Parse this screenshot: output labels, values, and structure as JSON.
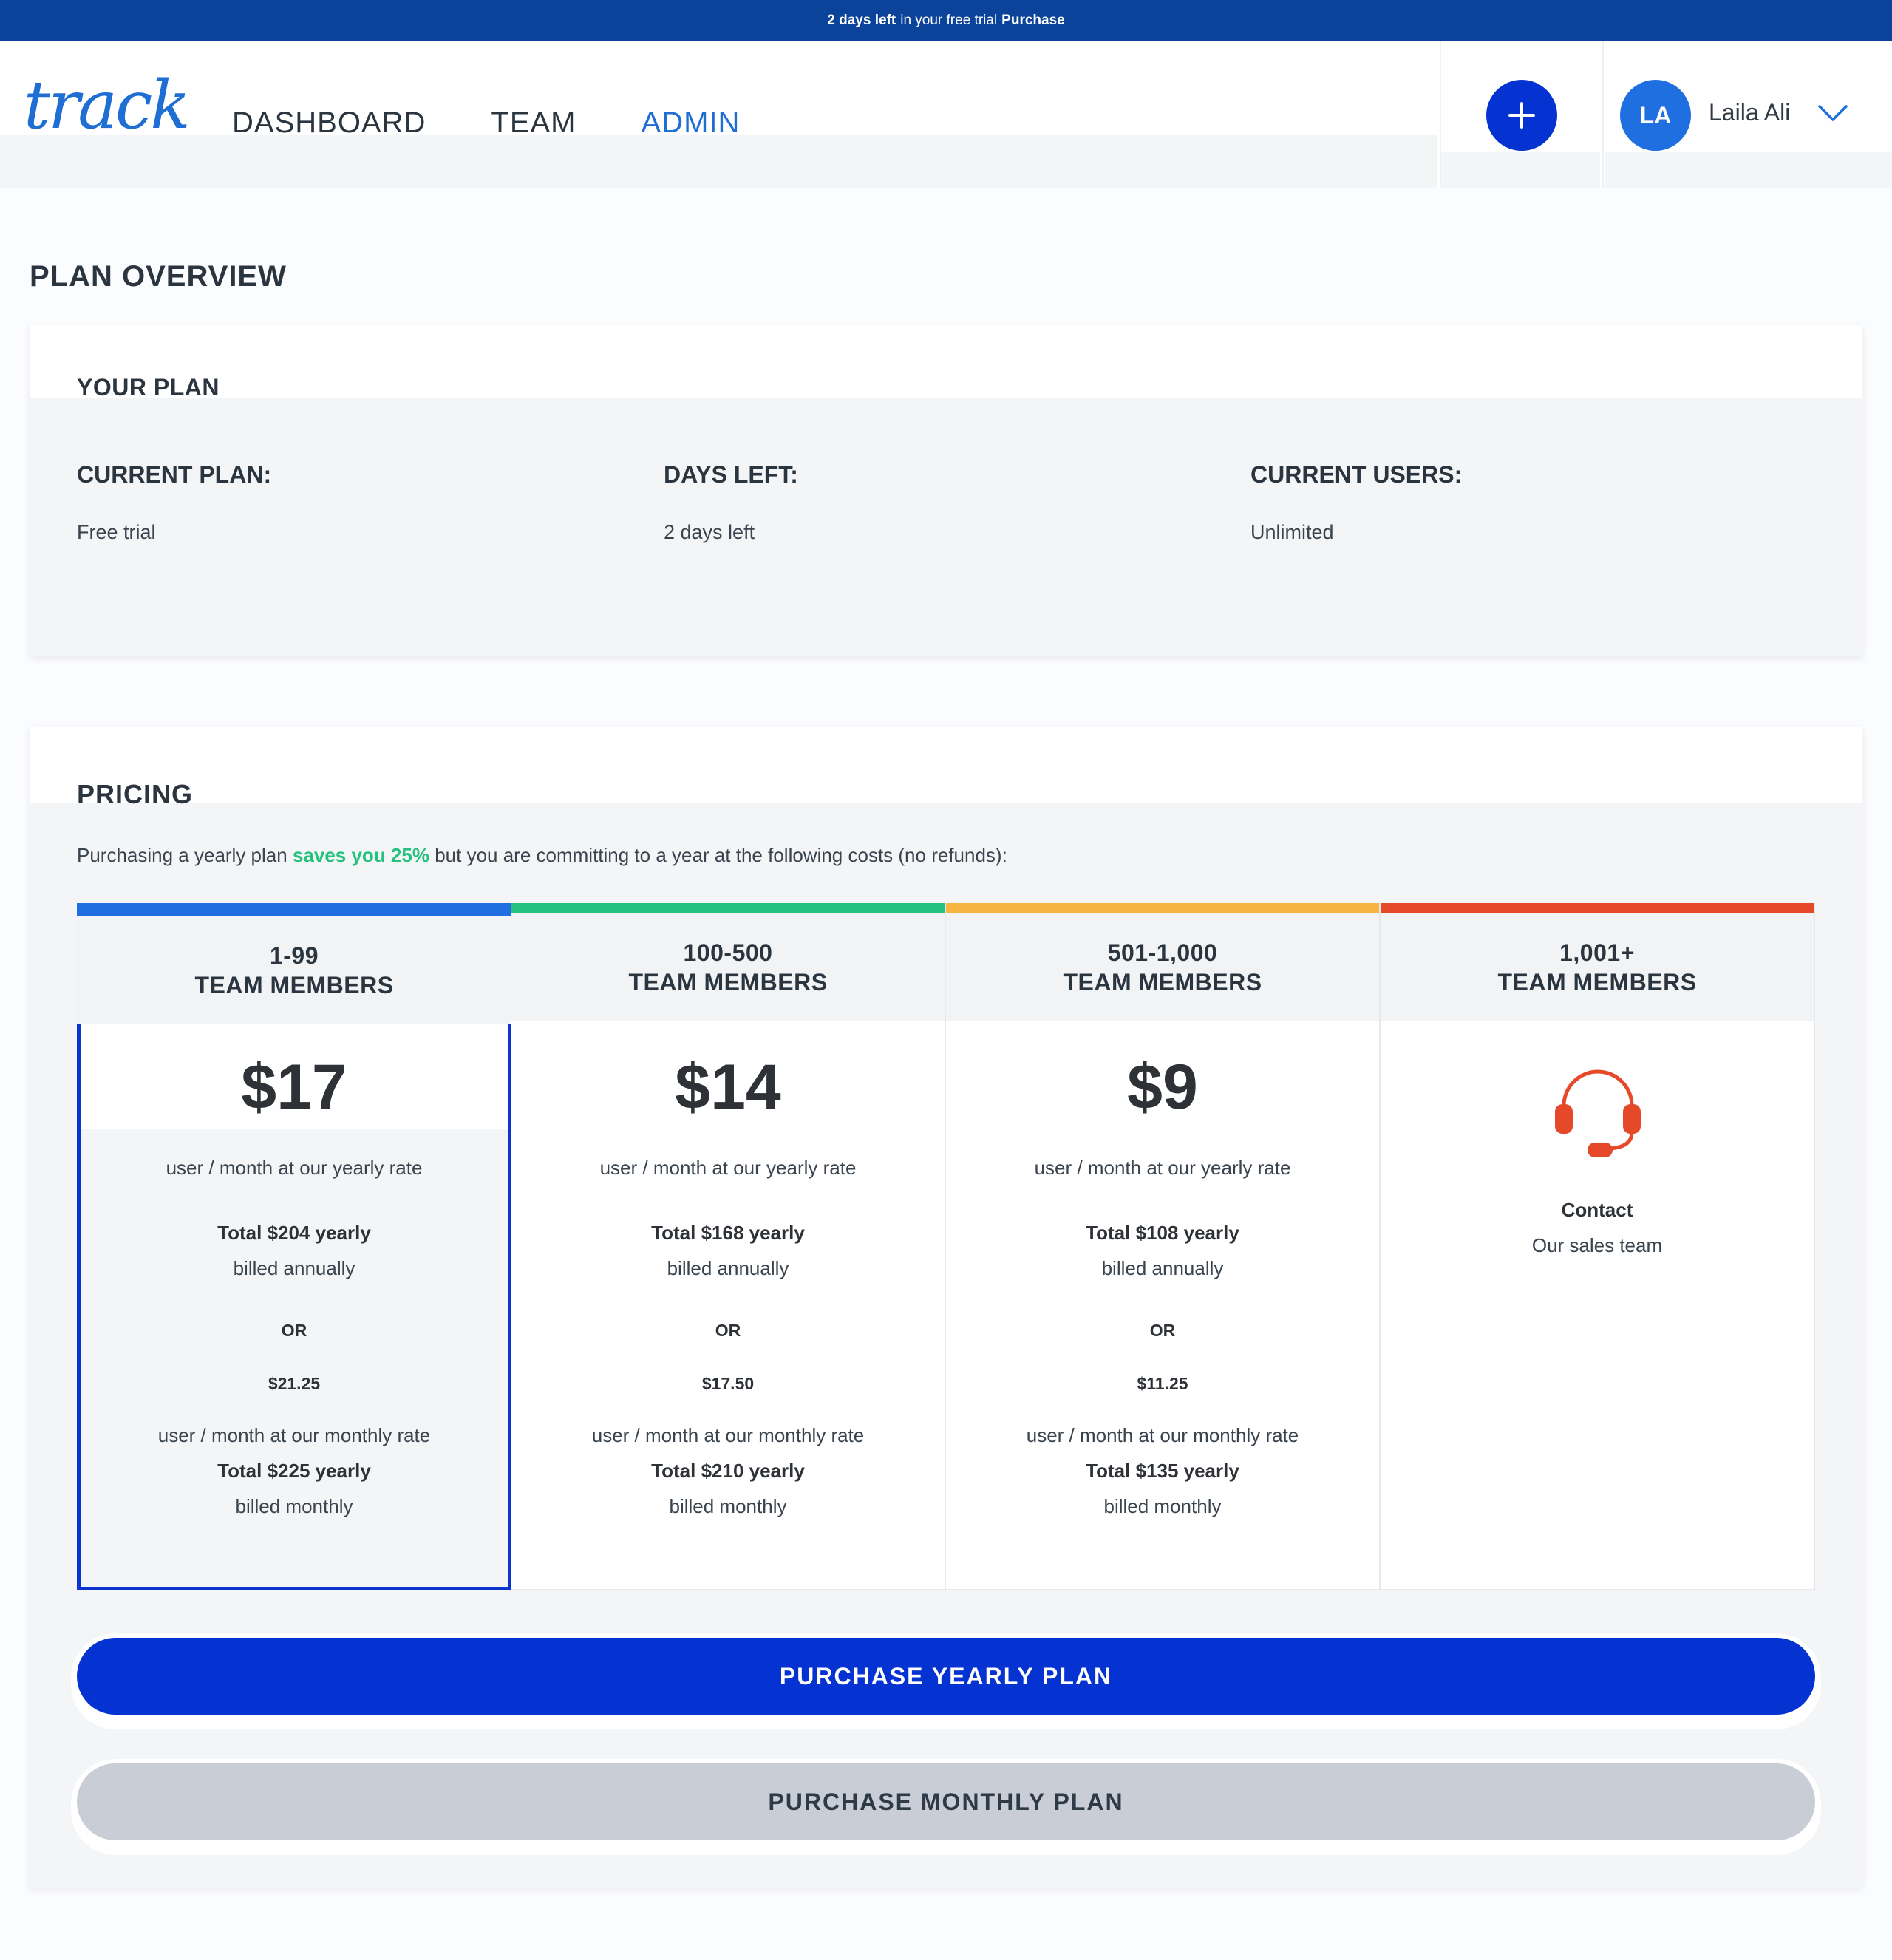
{
  "banner": {
    "days_left": "2 days left",
    "text": "in your free trial",
    "purchase": "Purchase"
  },
  "header": {
    "logo": "track",
    "nav": [
      "DASHBOARD",
      "TEAM",
      "ADMIN"
    ],
    "active_nav": "ADMIN",
    "add_icon": "plus-icon",
    "user_initials": "LA",
    "user_name": "Laila Ali",
    "user_menu_icon": "chevron-down-icon"
  },
  "page_title": "PLAN OVERVIEW",
  "your_plan": {
    "title": "YOUR PLAN",
    "current_plan_label": "CURRENT PLAN:",
    "current_plan_value": "Free trial",
    "days_left_label": "DAYS LEFT:",
    "days_left_value": "2 days left",
    "current_users_label": "CURRENT USERS:",
    "current_users_value": "Unlimited"
  },
  "pricing": {
    "title": "PRICING",
    "intro_before": "Purchasing a yearly plan",
    "intro_highlight": "saves you 25%",
    "intro_after": "but you are committing to a year at the following costs (no refunds):",
    "highlight_color": "#25c27f",
    "tiers": [
      {
        "range": "1-99",
        "members": "TEAM MEMBERS",
        "color": "#1f6fe0",
        "price": "$17",
        "yearly_rate": "user / month at our yearly rate",
        "yearly_total": "Total $204 yearly",
        "yearly_billing": "billed annually",
        "or": "OR",
        "monthly_price": "$21.25",
        "monthly_rate": "user / month at our monthly rate",
        "monthly_total": "Total $225 yearly",
        "monthly_billing": "billed monthly",
        "selected": true
      },
      {
        "range": "100-500",
        "members": "TEAM MEMBERS",
        "color": "#25c27f",
        "price": "$14",
        "yearly_rate": "user / month at our yearly rate",
        "yearly_total": "Total $168 yearly",
        "yearly_billing": "billed annually",
        "or": "OR",
        "monthly_price": "$17.50",
        "monthly_rate": "user / month at our monthly rate",
        "monthly_total": "Total $210 yearly",
        "monthly_billing": "billed monthly"
      },
      {
        "range": "501-1,000",
        "members": "TEAM MEMBERS",
        "color": "#f8b441",
        "price": "$9",
        "yearly_rate": "user / month at our yearly rate",
        "yearly_total": "Total $108 yearly",
        "yearly_billing": "billed annually",
        "or": "OR",
        "monthly_price": "$11.25",
        "monthly_rate": "user / month at our monthly rate",
        "monthly_total": "Total $135 yearly",
        "monthly_billing": "billed monthly"
      },
      {
        "range": "1,001+",
        "members": "TEAM MEMBERS",
        "color": "#e5492a",
        "icon": "headset-icon",
        "contact": "Contact",
        "contact_sub": "Our sales team"
      }
    ],
    "yearly_button": "PURCHASE YEARLY PLAN",
    "monthly_button": "PURCHASE MONTHLY PLAN"
  }
}
